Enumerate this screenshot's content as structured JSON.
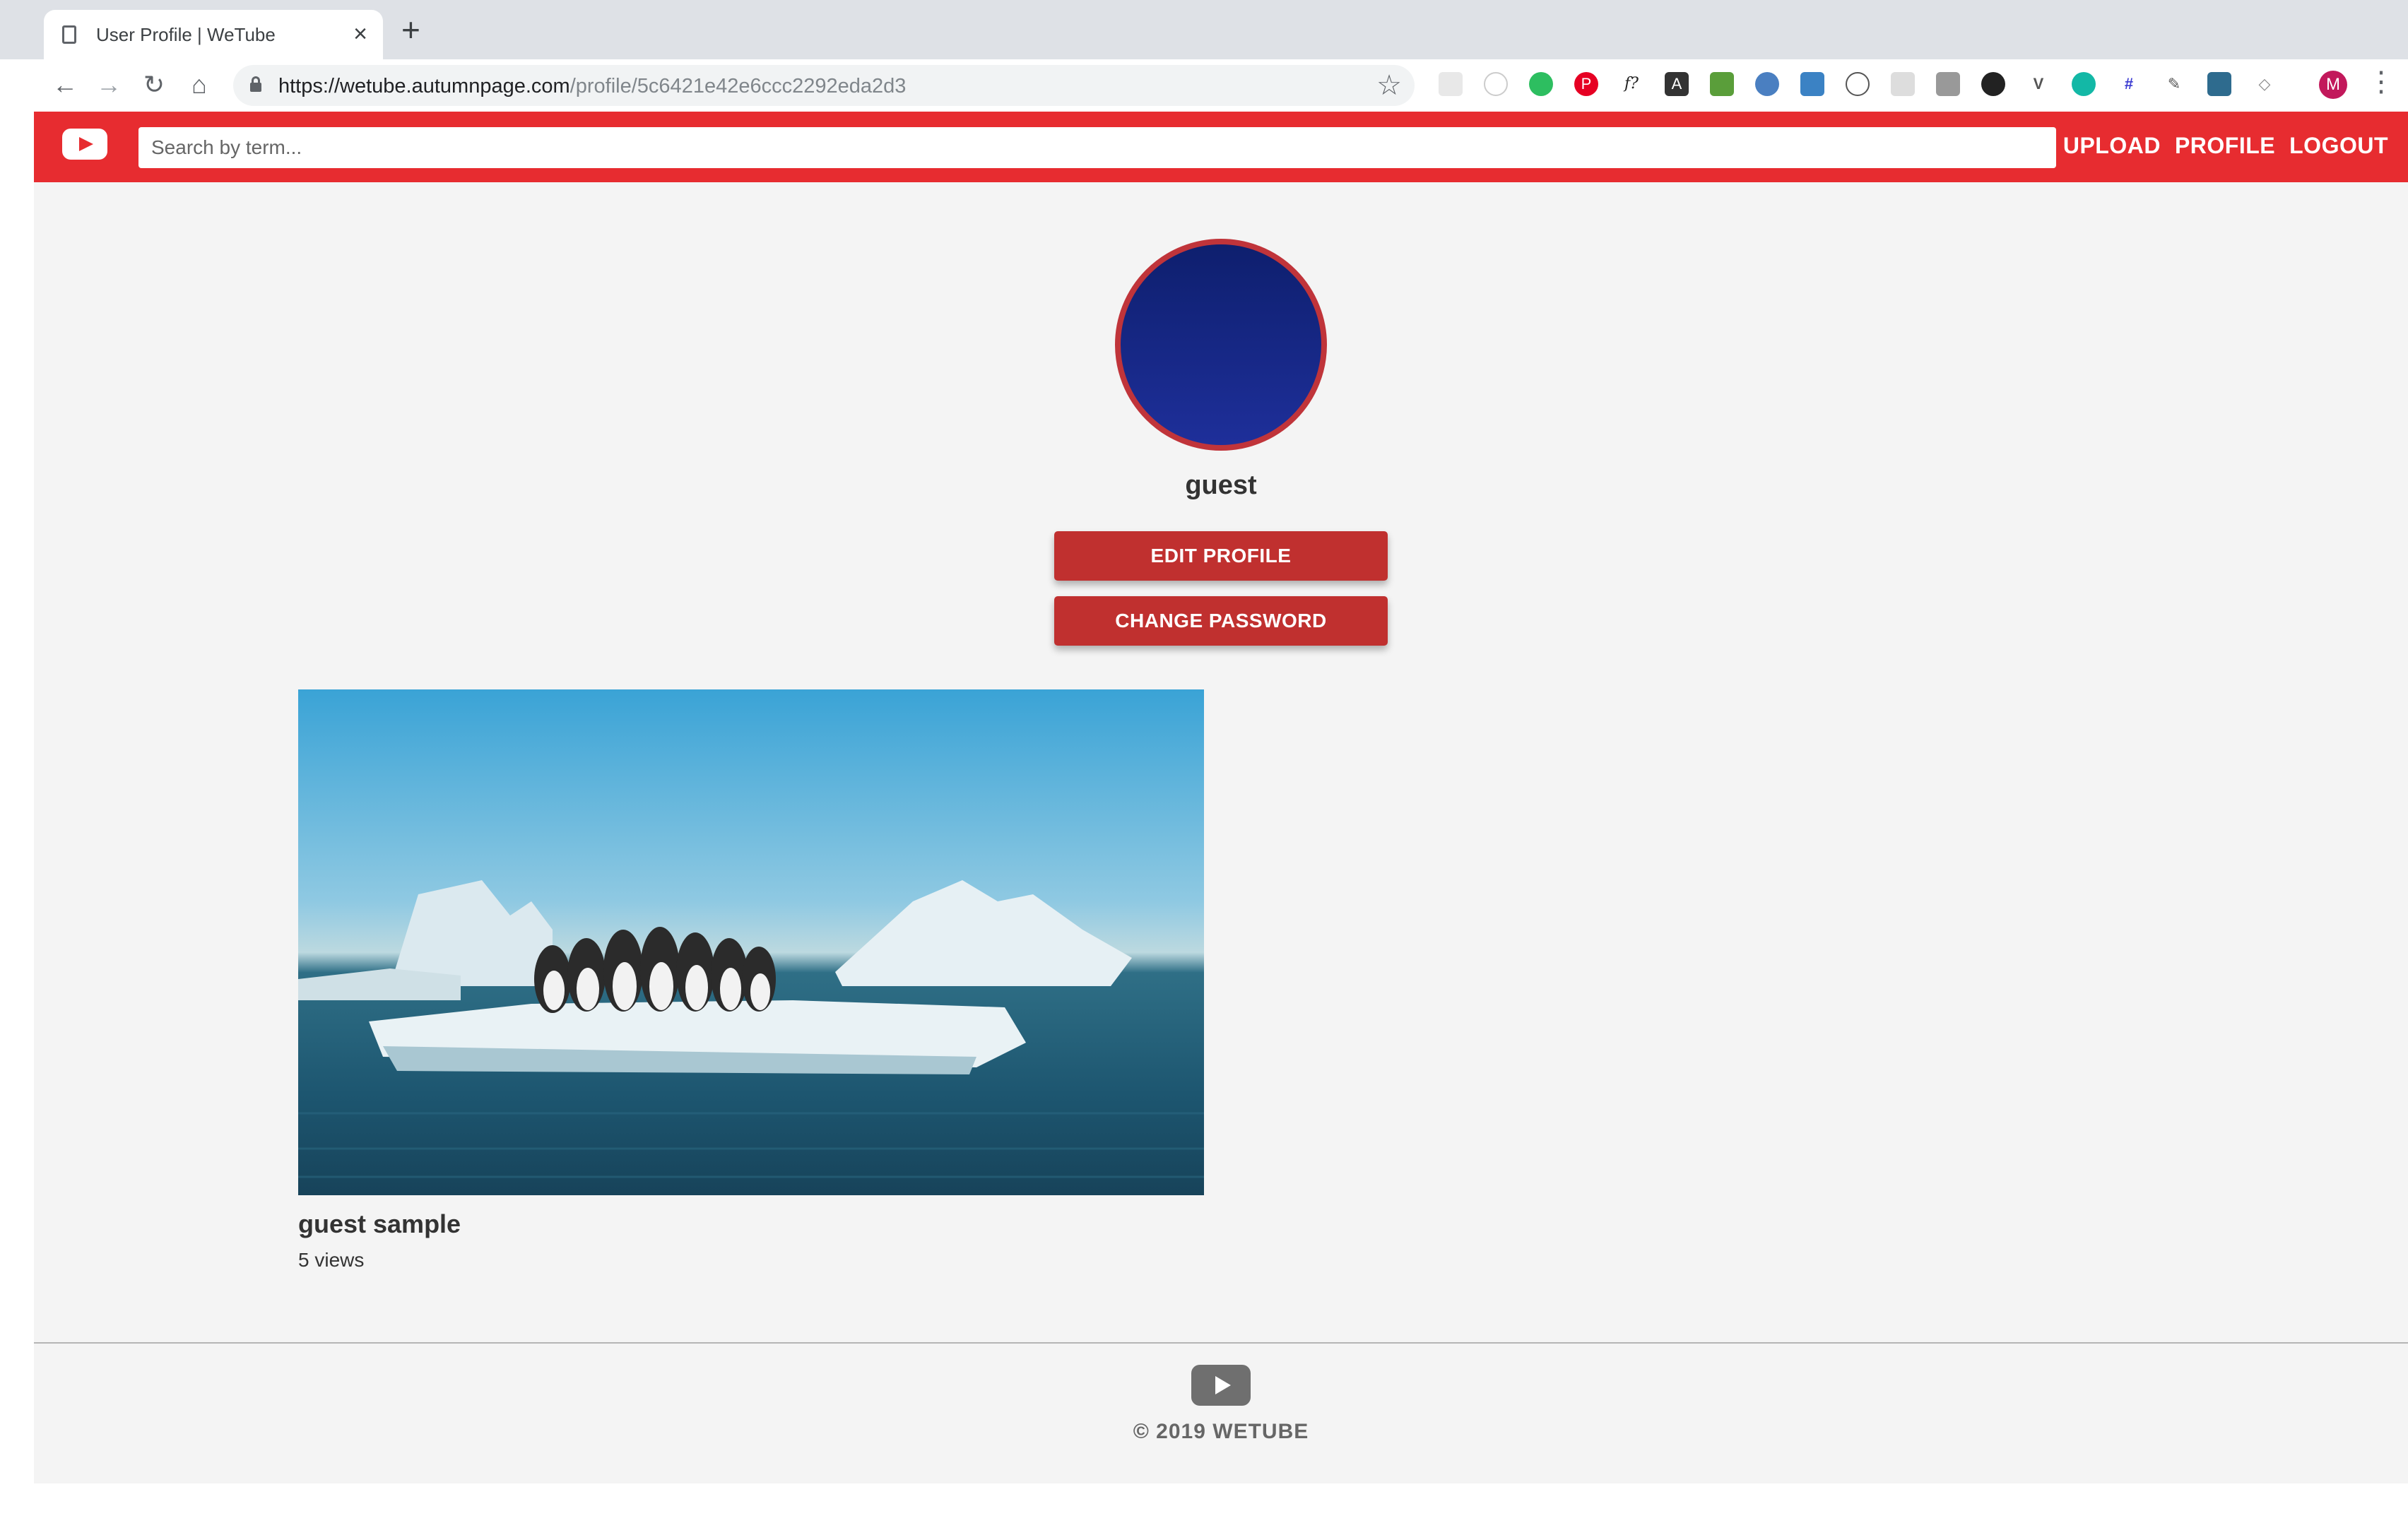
{
  "browser": {
    "tab_title": "User Profile | WeTube",
    "url_host": "https://wetube.autumnpage.com",
    "url_path": "/profile/5c6421e42e6ccc2292eda2d3",
    "profile_initial": "M"
  },
  "header": {
    "search_placeholder": "Search by term...",
    "links": [
      "UPLOAD",
      "PROFILE",
      "LOGOUT"
    ]
  },
  "profile": {
    "username": "guest",
    "edit_label": "EDIT PROFILE",
    "password_label": "CHANGE PASSWORD"
  },
  "videos": [
    {
      "title": "guest sample",
      "views": "5 views"
    }
  ],
  "footer": {
    "copyright": "© 2019 WETUBE"
  },
  "colors": {
    "brand_red": "#e72c30",
    "button_red": "#c0302f",
    "page_bg": "#f4f4f4"
  }
}
